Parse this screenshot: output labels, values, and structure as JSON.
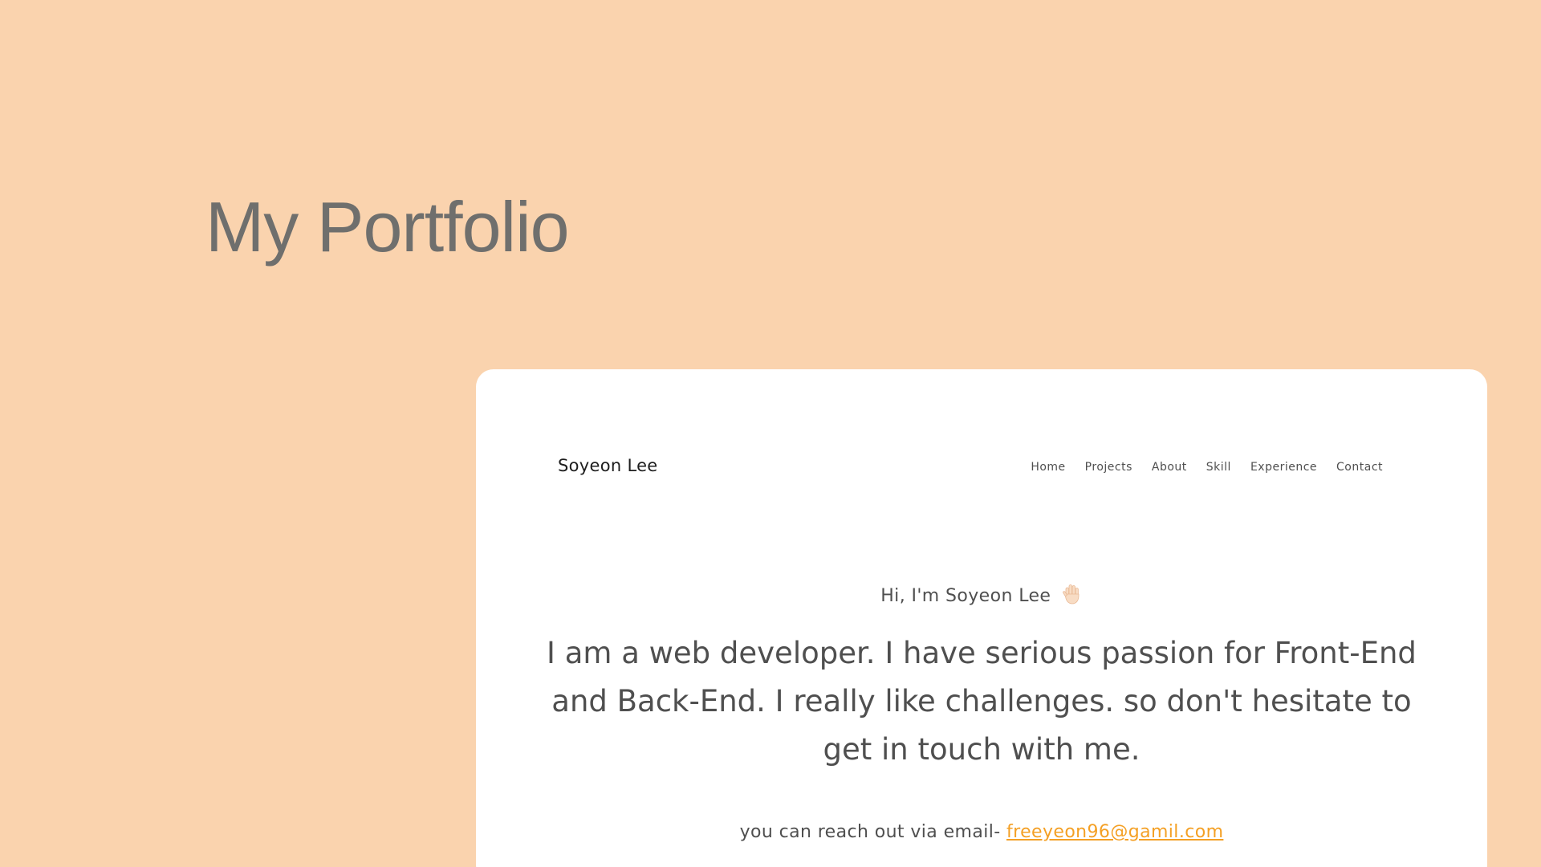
{
  "page": {
    "title": "My Portfolio"
  },
  "header": {
    "brand": "Soyeon Lee",
    "nav": [
      "Home",
      "Projects",
      "About",
      "Skill",
      "Experience",
      "Contact"
    ]
  },
  "hero": {
    "greeting": "Hi, I'm Soyeon Lee",
    "greeting_icon": "waving-hand-icon",
    "intro": "I am a web developer. I have serious passion for Front-End and Back-End. I really like challenges. so don't hesitate to get in touch with me.",
    "contact_prefix": "you can reach out via email-",
    "email": "freeyeon96@gamil.com"
  },
  "colors": {
    "background": "#fad3ae",
    "card": "#ffffff",
    "accent": "#f4a025",
    "text": "#4f4f4f",
    "title": "#6f6f6d"
  }
}
